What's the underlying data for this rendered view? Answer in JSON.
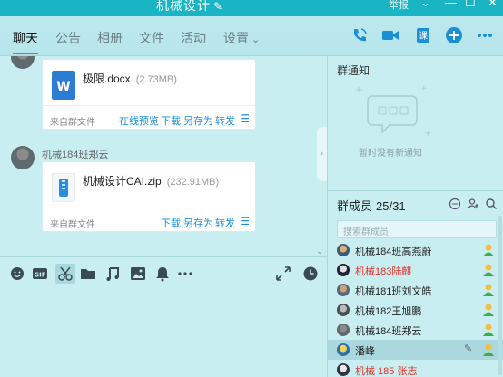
{
  "window": {
    "title": "机械设计",
    "report_label": "举报",
    "controls": [
      "⌄",
      "—",
      "☐",
      "✕"
    ]
  },
  "nav": {
    "tabs": [
      "聊天",
      "公告",
      "相册",
      "文件",
      "活动",
      "设置"
    ],
    "active_tab": "聊天",
    "accent": "#1aa6c7"
  },
  "chat": {
    "messages": [
      {
        "sender": "",
        "file_name": "极限.docx",
        "file_size": "(2.73MB)",
        "file_type": "word",
        "source": "来自群文件",
        "actions": [
          "在线预览",
          "下载",
          "另存为",
          "转发"
        ]
      },
      {
        "sender": "机械184班郑云",
        "file_name": "机械设计CAI.zip",
        "file_size": "(232.91MB)",
        "file_type": "zip",
        "source": "来自群文件",
        "actions": [
          "下载",
          "另存为",
          "转发"
        ]
      }
    ]
  },
  "toolbar": {
    "icons": [
      "emoji-icon",
      "gif-icon",
      "scissors-icon",
      "folder-icon",
      "music-icon",
      "image-icon",
      "bell-icon",
      "more-icon",
      "expand-icon",
      "history-icon"
    ]
  },
  "notice": {
    "title": "群通知",
    "empty_text": "暂时没有新通知"
  },
  "members": {
    "title": "群成员",
    "count": "25/31",
    "search_placeholder": "搜索群成员",
    "list": [
      {
        "name": "机械184班高燕蔚",
        "red": false,
        "role": "member"
      },
      {
        "name": "机械183陆麒",
        "red": true,
        "role": "member"
      },
      {
        "name": "机械181班刘文皓",
        "red": false,
        "role": "member"
      },
      {
        "name": "机械182王旭鹏",
        "red": false,
        "role": "member"
      },
      {
        "name": "机械184班郑云",
        "red": false,
        "role": "member"
      },
      {
        "name": "潘峰",
        "red": false,
        "role": "member",
        "highlight": true
      },
      {
        "name": "机械  185   张志",
        "red": true,
        "role": "member"
      }
    ]
  }
}
